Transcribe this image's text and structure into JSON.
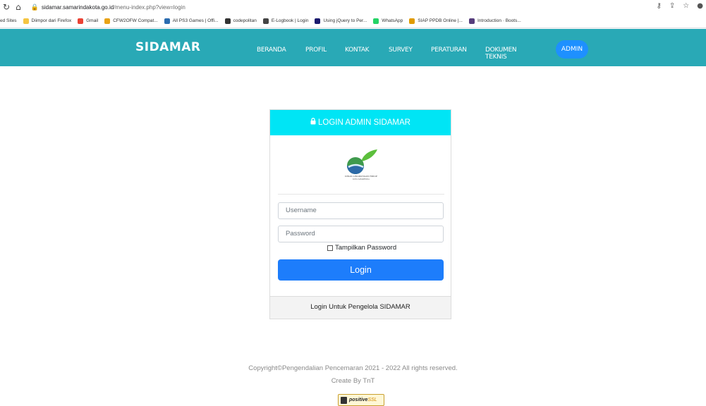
{
  "browser": {
    "url_domain": "sidamar.samarindakota.go.id",
    "url_path": "/menu-index.php?view=login",
    "bookmarks": [
      {
        "label": "ed Sites",
        "color": ""
      },
      {
        "label": "Diimpor dari Firefox",
        "color": "#f5c542"
      },
      {
        "label": "Gmail",
        "color": "#ea4335"
      },
      {
        "label": "CFW2OFW Compat...",
        "color": "#e8a317"
      },
      {
        "label": "All PS3 Games | Offi...",
        "color": "#2b6cb0"
      },
      {
        "label": "codepolitan",
        "color": "#333333"
      },
      {
        "label": "E-Logbook | Login",
        "color": "#444444"
      },
      {
        "label": "Using jQuery to Per...",
        "color": "#1a1a6e"
      },
      {
        "label": "WhatsApp",
        "color": "#25d366"
      },
      {
        "label": "SIAP PPDB Online |...",
        "color": "#e09b00"
      },
      {
        "label": "Introduction · Boots...",
        "color": "#563d7c"
      }
    ]
  },
  "navbar": {
    "brand": "SIDAMAR",
    "items": [
      "BERANDA",
      "PROFIL",
      "KONTAK",
      "SURVEY",
      "PERATURAN",
      "DOKUMEN TEKNIS"
    ],
    "active": "ADMIN"
  },
  "login": {
    "header": "LOGIN ADMIN SIDAMAR",
    "logo_caption": "DINAS LINGKUNGAN HIDUP",
    "logo_subcaption": "KOTA SAMARINDA",
    "username_placeholder": "Username",
    "password_placeholder": "Password",
    "show_password": "Tampilkan Password",
    "button": "Login",
    "footer": "Login Untuk Pengelola SIDAMAR"
  },
  "footer": {
    "copyright": "Copyright©Pengendalian Pencemaran 2021 - 2022 All rights reserved.",
    "created_by": "Create By TnT",
    "ssl_badge": "positive",
    "ssl_badge_suffix": "SSL"
  },
  "colors": {
    "navbar": "#29a9b6",
    "card_header": "#00e5f5",
    "button": "#1d7dfb",
    "active_nav": "#1e90ff"
  }
}
